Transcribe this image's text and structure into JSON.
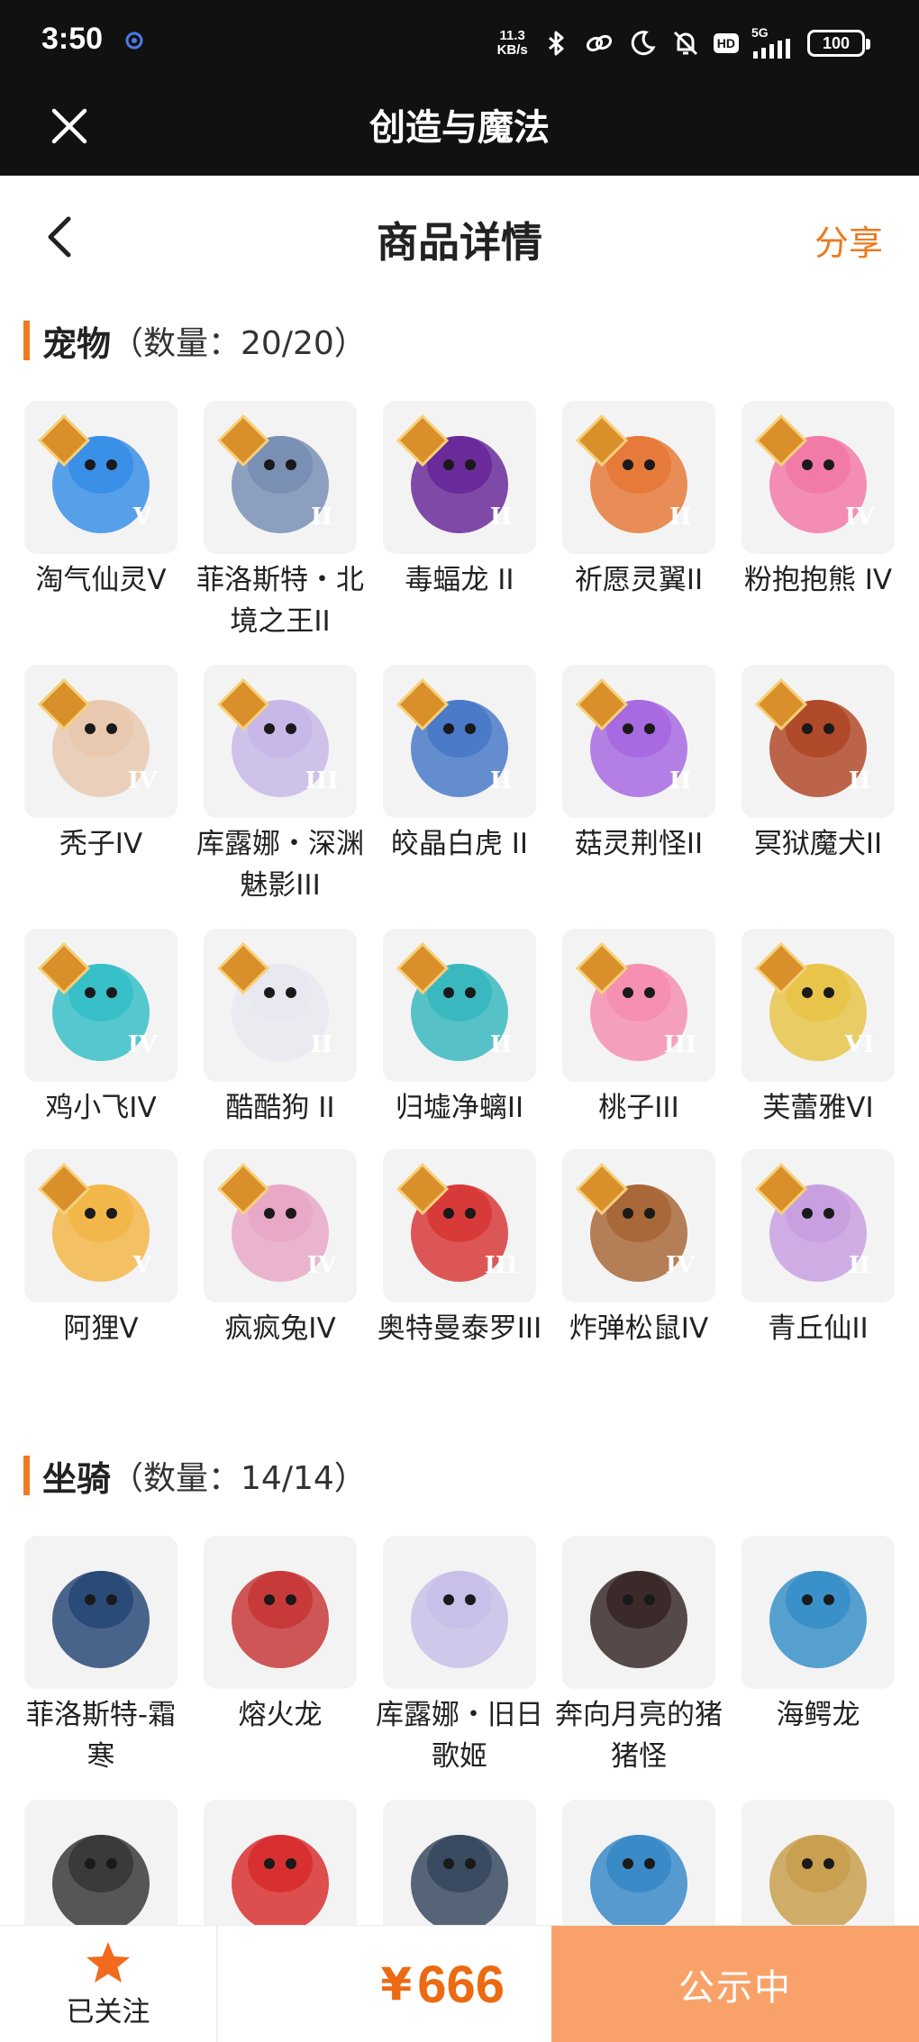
{
  "status_bar": {
    "time": "3:50",
    "net_speed_value": "11.3",
    "net_speed_unit": "KB/s",
    "hd": "HD",
    "network": "5G",
    "battery": "100"
  },
  "app_bar": {
    "title": "创造与魔法"
  },
  "nav": {
    "title": "商品详情",
    "share": "分享"
  },
  "colors": {
    "accent": "#ec7a1e",
    "price": "#ec6a12",
    "status_button": "#f8a26a",
    "header_bg": "#111111"
  },
  "pets": {
    "label": "宠物",
    "count": "（数量：20/20）",
    "items": [
      {
        "name": "淘气仙灵V",
        "tier": "V",
        "color": "#3a8fe6"
      },
      {
        "name": "菲洛斯特・北境之王II",
        "tier": "II",
        "color": "#7a8fb4"
      },
      {
        "name": "毒蝠龙 II",
        "tier": "II",
        "color": "#6a2a9a"
      },
      {
        "name": "祈愿灵翼II",
        "tier": "II",
        "color": "#e67a3a"
      },
      {
        "name": "粉抱抱熊 IV",
        "tier": "IV",
        "color": "#f27aa8"
      },
      {
        "name": "秃子IV",
        "tier": "IV",
        "color": "#e8c9b0"
      },
      {
        "name": "库露娜・深渊魅影III",
        "tier": "III",
        "color": "#c8b8e8"
      },
      {
        "name": "皎晶白虎 II",
        "tier": "II",
        "color": "#4a7ac8"
      },
      {
        "name": "菇灵荆怪II",
        "tier": "II",
        "color": "#a86ae0"
      },
      {
        "name": "冥狱魔犬II",
        "tier": "II",
        "color": "#b04a2a"
      },
      {
        "name": "鸡小飞IV",
        "tier": "IV",
        "color": "#38c0c8"
      },
      {
        "name": "酷酷狗 II",
        "tier": "II",
        "color": "#e8e8f0"
      },
      {
        "name": "归墟净螭II",
        "tier": "II",
        "color": "#3ab8c0"
      },
      {
        "name": "桃子III",
        "tier": "III",
        "color": "#f590b0"
      },
      {
        "name": "芙蕾雅VI",
        "tier": "VI",
        "color": "#e8c44a"
      },
      {
        "name": "阿狸V",
        "tier": "V",
        "color": "#f2b64a"
      },
      {
        "name": "疯疯兔IV",
        "tier": "IV",
        "color": "#e8a8c8"
      },
      {
        "name": "奥特曼泰罗III",
        "tier": "III",
        "color": "#d83a3a"
      },
      {
        "name": "炸弹松鼠IV",
        "tier": "IV",
        "color": "#a8683a"
      },
      {
        "name": "青丘仙II",
        "tier": "II",
        "color": "#c8a0e0"
      }
    ]
  },
  "mounts": {
    "label": "坐骑",
    "count": "（数量：14/14）",
    "items": [
      {
        "name": "菲洛斯特-霜寒",
        "color": "#2a4a78"
      },
      {
        "name": "熔火龙",
        "color": "#c83a3a"
      },
      {
        "name": "库露娜・旧日歌姬",
        "color": "#c8c0e8"
      },
      {
        "name": "奔向月亮的猪猪怪",
        "color": "#3a2a2a"
      },
      {
        "name": "海鳄龙",
        "color": "#3a90c8"
      },
      {
        "name": "",
        "color": "#3a3a3a"
      },
      {
        "name": "",
        "color": "#d83030"
      },
      {
        "name": "",
        "color": "#3a4a60"
      },
      {
        "name": "",
        "color": "#3a8ac8"
      },
      {
        "name": "",
        "color": "#c8a050"
      }
    ]
  },
  "bottom_bar": {
    "follow_label": "已关注",
    "currency": "¥",
    "price": "666",
    "status": "公示中"
  }
}
